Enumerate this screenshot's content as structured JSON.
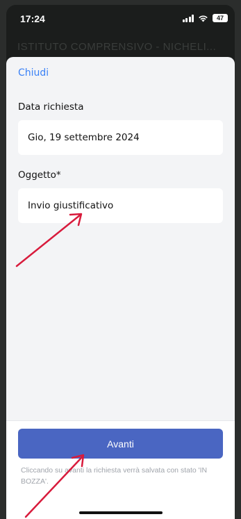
{
  "status_bar": {
    "time": "17:24",
    "battery": "47",
    "icons": [
      "signal-icon",
      "wifi-icon",
      "battery-icon"
    ]
  },
  "background_title": "ISTITUTO COMPRENSIVO - NICHELI...",
  "sheet": {
    "close_label": "Chiudi",
    "date_field": {
      "label": "Data richiesta",
      "value": "Gio, 19 settembre 2024"
    },
    "subject_field": {
      "label": "Oggetto*",
      "value": "Invio giustificativo"
    }
  },
  "footer": {
    "next_button_label": "Avanti",
    "hint": "Cliccando su avanti la richiesta verrà salvata con stato 'IN BOZZA'."
  },
  "colors": {
    "accent": "#3b82f6",
    "button": "#4a66c2",
    "annotation_arrow": "#d81b3c"
  }
}
